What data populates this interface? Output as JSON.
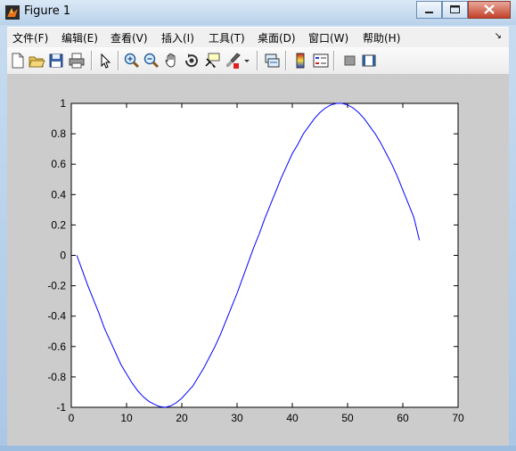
{
  "window": {
    "title": "Figure 1"
  },
  "menu": {
    "items": [
      {
        "label": "文件(F)",
        "name": "menu-file"
      },
      {
        "label": "编辑(E)",
        "name": "menu-edit"
      },
      {
        "label": "查看(V)",
        "name": "menu-view"
      },
      {
        "label": "插入(I)",
        "name": "menu-insert"
      },
      {
        "label": "工具(T)",
        "name": "menu-tools"
      },
      {
        "label": "桌面(D)",
        "name": "menu-desktop"
      },
      {
        "label": "窗口(W)",
        "name": "menu-window"
      },
      {
        "label": "帮助(H)",
        "name": "menu-help"
      }
    ]
  },
  "toolbar": {
    "icons": [
      "new-figure-icon",
      "open-file-icon",
      "save-icon",
      "print-icon",
      "pointer-icon",
      "zoom-in-icon",
      "zoom-out-icon",
      "pan-hand-icon",
      "rotate-3d-icon",
      "data-cursor-icon",
      "brush-icon",
      "brush-dropdown-icon",
      "link-plot-icon",
      "insert-colorbar-icon",
      "insert-legend-icon",
      "hide-plot-tools-icon",
      "show-plot-tools-icon"
    ]
  },
  "colors": {
    "line": "#0000ff",
    "axes_bg": "#ffffff",
    "figure_bg": "#cccccc"
  },
  "chart_data": {
    "type": "line",
    "title": "",
    "xlabel": "",
    "ylabel": "",
    "xlim": [
      0,
      70
    ],
    "ylim": [
      -1,
      1
    ],
    "xticks": [
      "0",
      "10",
      "20",
      "30",
      "40",
      "50",
      "60",
      "70"
    ],
    "yticks": [
      "-1",
      "-0.8",
      "-0.6",
      "-0.4",
      "-0.2",
      "0",
      "0.2",
      "0.4",
      "0.6",
      "0.8",
      "1"
    ],
    "grid": false,
    "series": [
      {
        "x": [
          1,
          2,
          3,
          4,
          5,
          6,
          7,
          8,
          9,
          10,
          11,
          12,
          13,
          14,
          15,
          16,
          17,
          18,
          19,
          20,
          21,
          22,
          23,
          24,
          25,
          26,
          27,
          28,
          29,
          30,
          31,
          32,
          33,
          34,
          35,
          36,
          37,
          38,
          39,
          40,
          41,
          42,
          43,
          44,
          45,
          46,
          47,
          48,
          49,
          50,
          51,
          52,
          53,
          54,
          55,
          56,
          57,
          58,
          59,
          60,
          61,
          62,
          63
        ],
        "y": [
          0,
          -0.1,
          -0.2,
          -0.29,
          -0.38,
          -0.48,
          -0.56,
          -0.64,
          -0.72,
          -0.78,
          -0.84,
          -0.89,
          -0.93,
          -0.96,
          -0.98,
          -0.995,
          -1.0,
          -0.99,
          -0.97,
          -0.94,
          -0.9,
          -0.86,
          -0.8,
          -0.74,
          -0.67,
          -0.6,
          -0.52,
          -0.43,
          -0.34,
          -0.25,
          -0.15,
          -0.05,
          0.05,
          0.14,
          0.24,
          0.33,
          0.42,
          0.51,
          0.59,
          0.67,
          0.73,
          0.8,
          0.85,
          0.9,
          0.94,
          0.97,
          0.99,
          1.0,
          1.0,
          0.99,
          0.97,
          0.94,
          0.9,
          0.85,
          0.8,
          0.74,
          0.67,
          0.6,
          0.52,
          0.43,
          0.34,
          0.25,
          0.1
        ]
      }
    ]
  }
}
